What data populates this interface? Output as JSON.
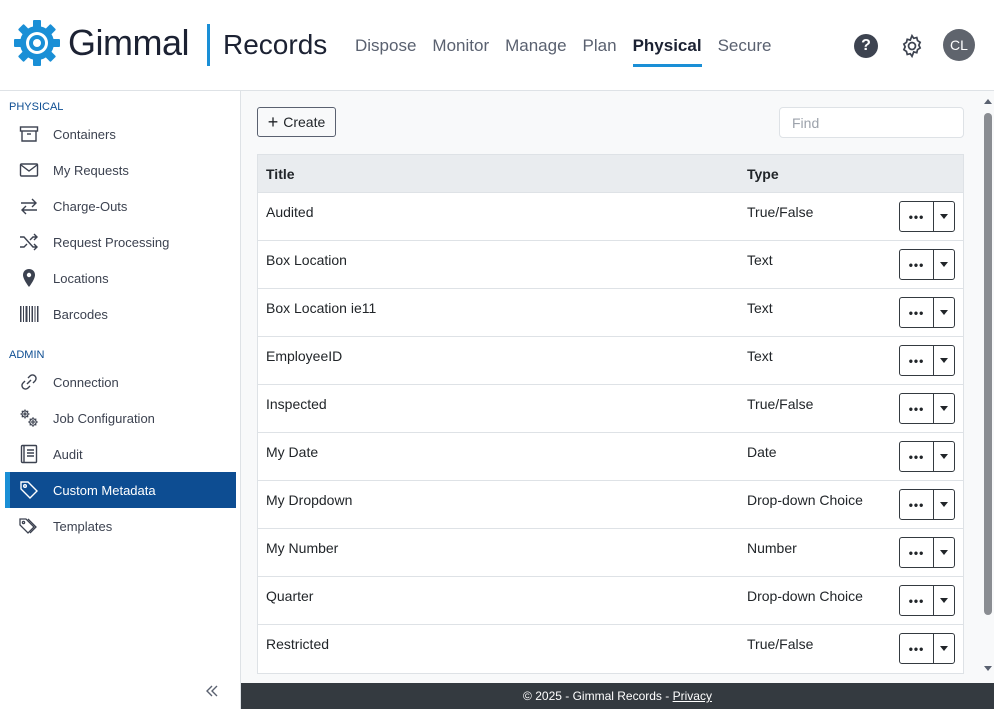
{
  "header": {
    "brand": "Gimmal",
    "product": "Records",
    "nav": [
      "Dispose",
      "Monitor",
      "Manage",
      "Plan",
      "Physical",
      "Secure"
    ],
    "active_nav": "Physical",
    "help_glyph": "?",
    "avatar_initials": "CL",
    "accent_color": "#1a8fd6",
    "brand_color": "#1c2233"
  },
  "sidebar": {
    "sections": [
      {
        "title": "PHYSICAL",
        "items": [
          {
            "label": "Containers",
            "icon": "archive-box-icon"
          },
          {
            "label": "My Requests",
            "icon": "envelope-icon"
          },
          {
            "label": "Charge-Outs",
            "icon": "swap-arrows-icon"
          },
          {
            "label": "Request Processing",
            "icon": "shuffle-icon"
          },
          {
            "label": "Locations",
            "icon": "map-pin-icon"
          },
          {
            "label": "Barcodes",
            "icon": "barcode-icon"
          }
        ]
      },
      {
        "title": "ADMIN",
        "items": [
          {
            "label": "Connection",
            "icon": "link-icon"
          },
          {
            "label": "Job Configuration",
            "icon": "gears-icon"
          },
          {
            "label": "Audit",
            "icon": "book-icon"
          },
          {
            "label": "Custom Metadata",
            "icon": "tag-icon"
          },
          {
            "label": "Templates",
            "icon": "tags-icon"
          }
        ]
      }
    ],
    "active_item": "Custom Metadata",
    "active_color": "#0d4d92"
  },
  "toolbar": {
    "create_label": "Create",
    "find_placeholder": "Find"
  },
  "table": {
    "columns": [
      "Title",
      "Type"
    ],
    "rows": [
      {
        "title": "Audited",
        "type": "True/False"
      },
      {
        "title": "Box Location",
        "type": "Text"
      },
      {
        "title": "Box Location ie11",
        "type": "Text"
      },
      {
        "title": "EmployeeID",
        "type": "Text"
      },
      {
        "title": "Inspected",
        "type": "True/False"
      },
      {
        "title": "My Date",
        "type": "Date"
      },
      {
        "title": "My Dropdown",
        "type": "Drop-down Choice"
      },
      {
        "title": "My Number",
        "type": "Number"
      },
      {
        "title": "Quarter",
        "type": "Drop-down Choice"
      },
      {
        "title": "Restricted",
        "type": "True/False"
      }
    ]
  },
  "footer": {
    "text": "© 2025 - Gimmal Records - ",
    "privacy_link": "Privacy"
  }
}
